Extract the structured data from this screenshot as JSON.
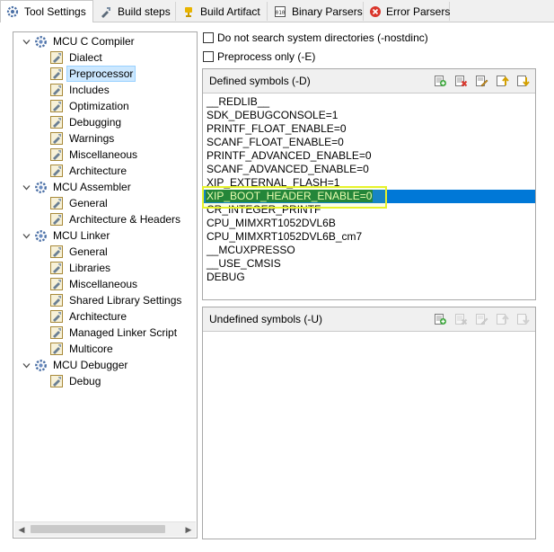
{
  "tabs": [
    {
      "label": "Tool Settings",
      "icon": "tool-settings-icon",
      "active": true
    },
    {
      "label": "Build steps",
      "icon": "build-steps-icon"
    },
    {
      "label": "Build Artifact",
      "icon": "build-artifact-icon"
    },
    {
      "label": "Binary Parsers",
      "icon": "binary-parsers-icon"
    },
    {
      "label": "Error Parsers",
      "icon": "error-parsers-icon"
    }
  ],
  "tree": {
    "items": [
      {
        "label": "MCU C Compiler",
        "level": 0,
        "expanded": true
      },
      {
        "label": "Dialect",
        "level": 1
      },
      {
        "label": "Preprocessor",
        "level": 1,
        "selected": true
      },
      {
        "label": "Includes",
        "level": 1
      },
      {
        "label": "Optimization",
        "level": 1
      },
      {
        "label": "Debugging",
        "level": 1
      },
      {
        "label": "Warnings",
        "level": 1
      },
      {
        "label": "Miscellaneous",
        "level": 1
      },
      {
        "label": "Architecture",
        "level": 1
      },
      {
        "label": "MCU Assembler",
        "level": 0,
        "expanded": true
      },
      {
        "label": "General",
        "level": 1
      },
      {
        "label": "Architecture & Headers",
        "level": 1
      },
      {
        "label": "MCU Linker",
        "level": 0,
        "expanded": true
      },
      {
        "label": "General",
        "level": 1
      },
      {
        "label": "Libraries",
        "level": 1
      },
      {
        "label": "Miscellaneous",
        "level": 1
      },
      {
        "label": "Shared Library Settings",
        "level": 1
      },
      {
        "label": "Architecture",
        "level": 1
      },
      {
        "label": "Managed Linker Script",
        "level": 1
      },
      {
        "label": "Multicore",
        "level": 1
      },
      {
        "label": "MCU Debugger",
        "level": 0,
        "expanded": true
      },
      {
        "label": "Debug",
        "level": 1
      }
    ]
  },
  "options": {
    "nostdinc_label": "Do not search system directories (-nostdinc)",
    "nostdinc_checked": false,
    "preprocess_only_label": "Preprocess only (-E)",
    "preprocess_only_checked": false
  },
  "defined": {
    "title": "Defined symbols (-D)",
    "tools": [
      "add-icon",
      "delete-icon",
      "edit-icon",
      "move-up-icon",
      "move-down-icon"
    ],
    "symbols": [
      "__REDLIB__",
      "SDK_DEBUGCONSOLE=1",
      "PRINTF_FLOAT_ENABLE=0",
      "SCANF_FLOAT_ENABLE=0",
      "PRINTF_ADVANCED_ENABLE=0",
      "SCANF_ADVANCED_ENABLE=0",
      "XIP_EXTERNAL_FLASH=1",
      "XIP_BOOT_HEADER_ENABLE=0",
      "CR_INTEGER_PRINTF",
      "CPU_MIMXRT1052DVL6B",
      "CPU_MIMXRT1052DVL6B_cm7",
      "__MCUXPRESSO",
      "__USE_CMSIS",
      "DEBUG"
    ],
    "selected_index": 7
  },
  "undefined": {
    "title": "Undefined symbols (-U)",
    "tools": [
      "add-icon",
      "delete-icon",
      "edit-icon",
      "move-up-icon",
      "move-down-icon"
    ],
    "symbols": []
  },
  "colors": {
    "selection": "#0078d7",
    "tree_selection": "#cce8ff",
    "highlight_box": "#e6f22a"
  }
}
